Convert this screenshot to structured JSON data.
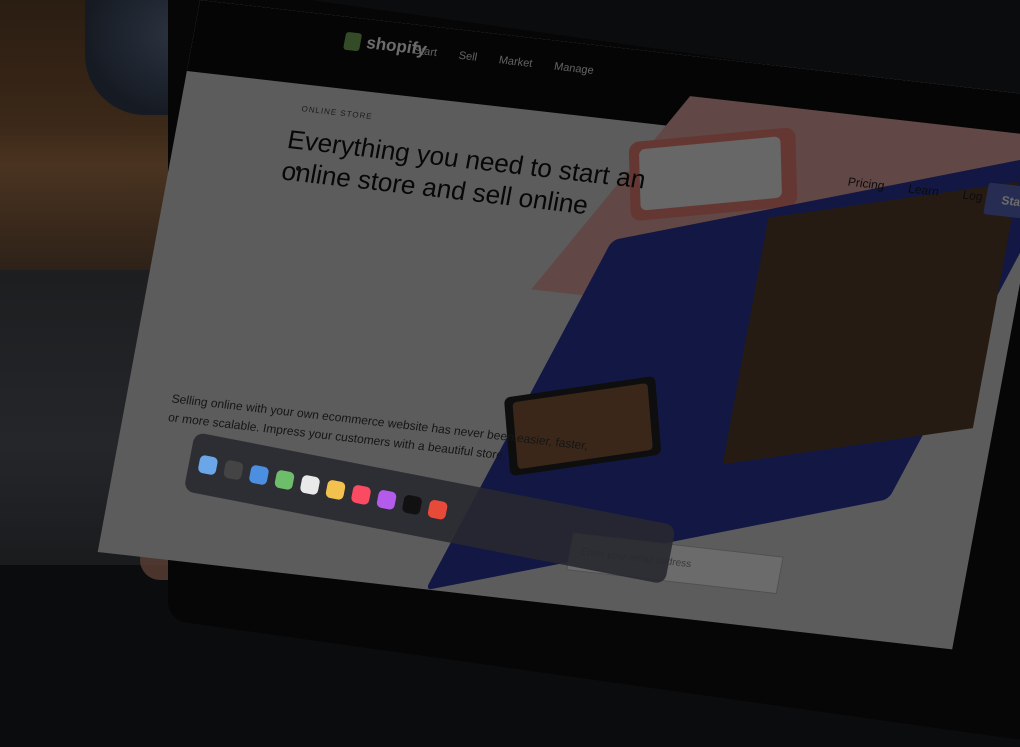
{
  "site": {
    "logo_text": "shopify",
    "nav": [
      "Start",
      "Sell",
      "Market",
      "Manage"
    ],
    "right_nav": [
      "Pricing",
      "Learn",
      "Log in"
    ],
    "cta": "Start"
  },
  "hero": {
    "eyebrow": "ONLINE STORE",
    "headline": "Everything you need to start an online store and sell online",
    "blurb": "Selling online with your own ecommerce website has never been easier, faster, or more scalable. Impress your customers with a beautiful store.",
    "email_placeholder": "Enter your email address"
  },
  "colors": {
    "brand_green": "#7ab55c",
    "accent_purple": "#5c6ac4",
    "pink_panel": "#e6a9a4",
    "blue_laptop": "#2a37a3"
  }
}
